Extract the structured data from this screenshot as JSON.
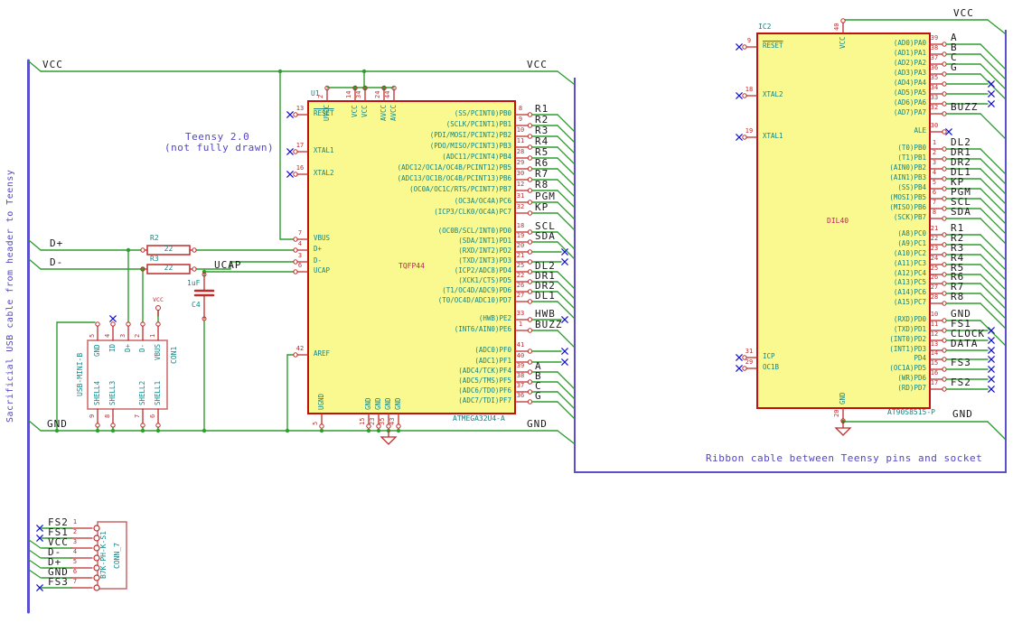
{
  "notes": {
    "left_vertical": "Sacrificial USB cable from header to Teensy",
    "teensy_line1": "Teensy 2.0",
    "teensy_line2": "(not fully drawn)",
    "ribbon": "Ribbon cable between Teensy pins and socket"
  },
  "labels": {
    "vcc_top_left": "VCC",
    "vcc_top_right": "VCC",
    "gnd_left": "GND",
    "gnd_right": "GND",
    "dplus": "D+",
    "dminus": "D-",
    "ucap": "UCAP",
    "ic2_vcc": "VCC",
    "ic2_gnd": "GND",
    "usb_vcc": "VCC"
  },
  "u1": {
    "ref": "U1",
    "value": "ATMEGA32U4-A",
    "footprint": "TQFP44",
    "left_pins": [
      {
        "num": "13",
        "name": "RESET",
        "conn": "x"
      },
      {
        "num": "17",
        "name": "XTAL1",
        "conn": "x"
      },
      {
        "num": "16",
        "name": "XTAL2",
        "conn": "x"
      },
      {
        "num": "7",
        "name": "VBUS",
        "conn": "wire"
      },
      {
        "num": "4",
        "name": "D+",
        "conn": "wire"
      },
      {
        "num": "3",
        "name": "D-",
        "conn": "wire"
      },
      {
        "num": "6",
        "name": "UCAP",
        "conn": "wire"
      },
      {
        "num": "42",
        "name": "AREF",
        "conn": "wire"
      }
    ],
    "top_pins": [
      {
        "num": "2",
        "name": "UVCC"
      },
      {
        "num": "14",
        "name": "VCC"
      },
      {
        "num": "34",
        "name": "VCC"
      },
      {
        "num": "24",
        "name": "AVCC"
      },
      {
        "num": "44",
        "name": "AVCC"
      }
    ],
    "bottom_pins": [
      {
        "num": "5",
        "name": "UGND"
      },
      {
        "num": "15",
        "name": "GND"
      },
      {
        "num": "23",
        "name": "GND"
      },
      {
        "num": "35",
        "name": "GND"
      },
      {
        "num": "43",
        "name": "GND"
      }
    ],
    "right_pins": [
      {
        "num": "8",
        "name": "(SS/PCINT0)PB0",
        "label": "R1",
        "conn": "tail"
      },
      {
        "num": "9",
        "name": "(SCLK/PCINT1)PB1",
        "label": "R2",
        "conn": "tail"
      },
      {
        "num": "10",
        "name": "(PDI/MOSI/PCINT2)PB2",
        "label": "R3",
        "conn": "tail"
      },
      {
        "num": "11",
        "name": "(PDO/MISO/PCINT3)PB3",
        "label": "R4",
        "conn": "tail"
      },
      {
        "num": "28",
        "name": "(ADC11/PCINT4)PB4",
        "label": "R5",
        "conn": "tail"
      },
      {
        "num": "29",
        "name": "(ADC12/OC1A/OC4B/PCINT12)PB5",
        "label": "R6",
        "conn": "tail"
      },
      {
        "num": "30",
        "name": "(ADC13/OC1B/OC4B/PCINT13)PB6",
        "label": "R7",
        "conn": "tail"
      },
      {
        "num": "12",
        "name": "(OC0A/OC1C/RTS/PCINT7)PB7",
        "label": "R8",
        "conn": "tail"
      },
      {
        "num": "31",
        "name": "(OC3A/OC4A)PC6",
        "label": "PGM",
        "conn": "tail"
      },
      {
        "num": "32",
        "name": "(ICP3/CLK0/OC4A)PC7",
        "label": "KP",
        "conn": "tail"
      },
      {
        "num": "18",
        "name": "(OC0B/SCL/INT0)PD0",
        "label": "SCL",
        "conn": "tail"
      },
      {
        "num": "19",
        "name": "(SDA/INT1)PD1",
        "label": "SDA",
        "conn": "tail"
      },
      {
        "num": "20",
        "name": "(RXD/INT2)PD2",
        "label": "",
        "conn": "x"
      },
      {
        "num": "21",
        "name": "(TXD/INT3)PD3",
        "label": "",
        "conn": "x"
      },
      {
        "num": "25",
        "name": "(ICP2/ADC8)PD4",
        "label": "DL2",
        "conn": "tail"
      },
      {
        "num": "22",
        "name": "(XCK1/CTS)PD5",
        "label": "DR1",
        "conn": "tail"
      },
      {
        "num": "26",
        "name": "(T1/OC4D/ADC9)PD6",
        "label": "DR2",
        "conn": "tail"
      },
      {
        "num": "27",
        "name": "(T0/OC4D/ADC10)PD7",
        "label": "DL1",
        "conn": "tail"
      },
      {
        "num": "33",
        "name": "(HWB)PE2",
        "label": "HWB",
        "conn": "x"
      },
      {
        "num": "1",
        "name": "(INT6/AIN0)PE6",
        "label": "BUZZ",
        "conn": "tail"
      },
      {
        "num": "41",
        "name": "(ADC0)PF0",
        "label": "",
        "conn": "x"
      },
      {
        "num": "40",
        "name": "(ADC1)PF1",
        "label": "",
        "conn": "x"
      },
      {
        "num": "39",
        "name": "(ADC4/TCK)PF4",
        "label": "A",
        "conn": "tail"
      },
      {
        "num": "38",
        "name": "(ADC5/TMS)PF5",
        "label": "B",
        "conn": "tail"
      },
      {
        "num": "37",
        "name": "(ADC6/TDO)PF6",
        "label": "C",
        "conn": "tail"
      },
      {
        "num": "36",
        "name": "(ADC7/TDI)PF7",
        "label": "G",
        "conn": "tail"
      }
    ]
  },
  "ic2": {
    "ref": "IC2",
    "value": "AT90S8515-P",
    "footprint": "DIL40",
    "left_pins": [
      {
        "num": "9",
        "name": "RESET",
        "conn": "x"
      },
      {
        "num": "18",
        "name": "XTAL2",
        "conn": "x"
      },
      {
        "num": "19",
        "name": "XTAL1",
        "conn": "x"
      },
      {
        "num": "31",
        "name": "ICP",
        "conn": "x"
      },
      {
        "num": "29",
        "name": "OC1B",
        "conn": "x"
      }
    ],
    "top_pins": [
      {
        "num": "40",
        "name": "VCC"
      }
    ],
    "bottom_pins": [
      {
        "num": "20",
        "name": "GND"
      }
    ],
    "right_pins": [
      {
        "num": "39",
        "name": "(AD0)PA0",
        "label": "A",
        "conn": "tail"
      },
      {
        "num": "38",
        "name": "(AD1)PA1",
        "label": "B",
        "conn": "tail"
      },
      {
        "num": "37",
        "name": "(AD2)PA2",
        "label": "C",
        "conn": "tail"
      },
      {
        "num": "36",
        "name": "(AD3)PA3",
        "label": "G",
        "conn": "tail"
      },
      {
        "num": "35",
        "name": "(AD4)PA4",
        "label": "",
        "conn": "x"
      },
      {
        "num": "34",
        "name": "(AD5)PA5",
        "label": "",
        "conn": "x"
      },
      {
        "num": "33",
        "name": "(AD6)PA6",
        "label": "",
        "conn": "x"
      },
      {
        "num": "32",
        "name": "(AD7)PA7",
        "label": "BUZZ",
        "conn": "tail"
      },
      {
        "num": "30",
        "name": "ALE",
        "label": "",
        "conn": "xn"
      },
      {
        "num": "1",
        "name": "(T0)PB0",
        "label": "DL2",
        "conn": "tail"
      },
      {
        "num": "2",
        "name": "(T1)PB1",
        "label": "DR1",
        "conn": "tail"
      },
      {
        "num": "3",
        "name": "(AIN0)PB2",
        "label": "DR2",
        "conn": "tail"
      },
      {
        "num": "4",
        "name": "(AIN1)PB3",
        "label": "DL1",
        "conn": "tail"
      },
      {
        "num": "5",
        "name": "(SS)PB4",
        "label": "KP",
        "conn": "tail"
      },
      {
        "num": "6",
        "name": "(MOSI)PB5",
        "label": "PGM",
        "conn": "tail"
      },
      {
        "num": "7",
        "name": "(MISO)PB6",
        "label": "SCL",
        "conn": "tail"
      },
      {
        "num": "8",
        "name": "(SCK)PB7",
        "label": "SDA",
        "conn": "tail"
      },
      {
        "num": "21",
        "name": "(A8)PC0",
        "label": "R1",
        "conn": "tail"
      },
      {
        "num": "22",
        "name": "(A9)PC1",
        "label": "R2",
        "conn": "tail"
      },
      {
        "num": "23",
        "name": "(A10)PC2",
        "label": "R3",
        "conn": "tail"
      },
      {
        "num": "24",
        "name": "(A11)PC3",
        "label": "R4",
        "conn": "tail"
      },
      {
        "num": "25",
        "name": "(A12)PC4",
        "label": "R5",
        "conn": "tail"
      },
      {
        "num": "26",
        "name": "(A13)PC5",
        "label": "R6",
        "conn": "tail"
      },
      {
        "num": "27",
        "name": "(A14)PC6",
        "label": "R7",
        "conn": "tail"
      },
      {
        "num": "28",
        "name": "(A15)PC7",
        "label": "R8",
        "conn": "tail"
      },
      {
        "num": "10",
        "name": "(RXD)PD0",
        "label": "GND",
        "conn": "tail"
      },
      {
        "num": "11",
        "name": "(TXD)PD1",
        "label": "FS1",
        "conn": "x"
      },
      {
        "num": "12",
        "name": "(INT0)PD2",
        "label": "CLOCK",
        "conn": "x"
      },
      {
        "num": "13",
        "name": "(INT1)PD3",
        "label": "DATA",
        "conn": "x"
      },
      {
        "num": "14",
        "name": "PD4",
        "label": "",
        "conn": "x"
      },
      {
        "num": "15",
        "name": "(OC1A)PD5",
        "label": "FS3",
        "conn": "x"
      },
      {
        "num": "16",
        "name": "(WR)PD6",
        "label": "",
        "conn": "x"
      },
      {
        "num": "17",
        "name": "(RD)PD7",
        "label": "FS2",
        "conn": "x"
      }
    ]
  },
  "r2": {
    "ref": "R2",
    "value": "22"
  },
  "r3": {
    "ref": "R3",
    "value": "22"
  },
  "c4": {
    "ref": "C4",
    "value": "1uF"
  },
  "usb": {
    "value": "USB-MINI-B",
    "ref": "CON1",
    "top_pins": [
      {
        "num": "5",
        "name": "GND"
      },
      {
        "num": "4",
        "name": "ID",
        "nc": true
      },
      {
        "num": "3",
        "name": "D+"
      },
      {
        "num": "2",
        "name": "D-"
      },
      {
        "num": "1",
        "name": "VBUS"
      }
    ],
    "bottom_pins": [
      {
        "num": "9",
        "name": "SHELL4"
      },
      {
        "num": "8",
        "name": "SHELL3"
      },
      {
        "num": "7",
        "name": "SHELL2"
      },
      {
        "num": "6",
        "name": "SHELL1"
      }
    ]
  },
  "conn7": {
    "value": "B7K-PH-K-S1",
    "ref": "CONN_7",
    "pins": [
      {
        "num": "1",
        "label": "FS2",
        "conn": "x"
      },
      {
        "num": "2",
        "label": "FS1",
        "conn": "x"
      },
      {
        "num": "3",
        "label": "VCC",
        "conn": "diag"
      },
      {
        "num": "4",
        "label": "D-",
        "conn": "diag"
      },
      {
        "num": "5",
        "label": "D+",
        "conn": "diag"
      },
      {
        "num": "6",
        "label": "GND",
        "conn": "diag"
      },
      {
        "num": "7",
        "label": "FS3",
        "conn": "x"
      }
    ]
  },
  "colors": {
    "wire": "#2f9e2f",
    "pin": "#bf2b2b",
    "body_outline": "#c01010",
    "body_fill": "#f9f98f",
    "connector_outline": "#cc6666",
    "no_connect": "#1616c8",
    "annotation_blue": "#5a50cc",
    "pin_name_teal": "#128585"
  }
}
